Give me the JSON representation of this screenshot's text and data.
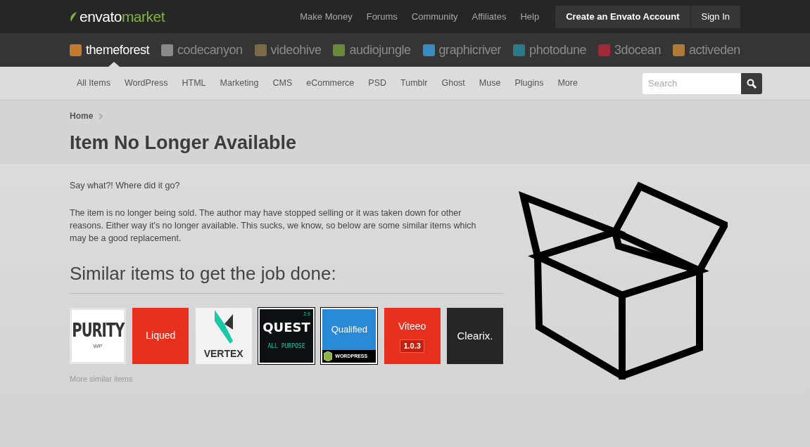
{
  "brand": {
    "name": "envato",
    "suffix": "market"
  },
  "top_links": [
    "Make Money",
    "Forums",
    "Community",
    "Affiliates",
    "Help"
  ],
  "account_buttons": [
    "Create an Envato Account",
    "Sign In"
  ],
  "sites": [
    {
      "label": "themeforest",
      "selected": true,
      "color": "#c47a2c"
    },
    {
      "label": "codecanyon",
      "selected": false,
      "color": "#8a8a8a"
    },
    {
      "label": "videohive",
      "selected": false,
      "color": "#7a6a4a"
    },
    {
      "label": "audiojungle",
      "selected": false,
      "color": "#6a8a3a"
    },
    {
      "label": "graphicriver",
      "selected": false,
      "color": "#3a8ac4"
    },
    {
      "label": "photodune",
      "selected": false,
      "color": "#2a7a8a"
    },
    {
      "label": "3docean",
      "selected": false,
      "color": "#a02a3a"
    },
    {
      "label": "activeden",
      "selected": false,
      "color": "#b07a3a"
    }
  ],
  "categories": [
    "All Items",
    "WordPress",
    "HTML",
    "Marketing",
    "CMS",
    "eCommerce",
    "PSD",
    "Tumblr",
    "Ghost",
    "Muse",
    "Plugins",
    "More"
  ],
  "search": {
    "placeholder": "Search"
  },
  "breadcrumb": [
    "Home"
  ],
  "page_title": "Item No Longer Available",
  "intro": "Say what?! Where did it go?",
  "body": "The item is no longer being sold. The author may have stopped selling or it was taken down for other reasons. Either way it's no longer available. This sucks, we know, so below are some similar items which may be a good replacement.",
  "similar_heading": "Similar items to get the job done:",
  "similar_items": [
    {
      "kind": "purity",
      "title": "PURITY",
      "subtitle": "WP"
    },
    {
      "kind": "red",
      "title": "Liqued"
    },
    {
      "kind": "vertex",
      "title": "VERTEX"
    },
    {
      "kind": "quest",
      "version": "2.9",
      "title": "QUEST",
      "subtitle": "ALL PURPOSE"
    },
    {
      "kind": "qualified",
      "title": "Qualified",
      "footer": "WORDPRESS"
    },
    {
      "kind": "red",
      "title": "Viteeo",
      "badge": "1.0.3"
    },
    {
      "kind": "dark",
      "title": "Clearix."
    }
  ],
  "more_link": "More similar items"
}
